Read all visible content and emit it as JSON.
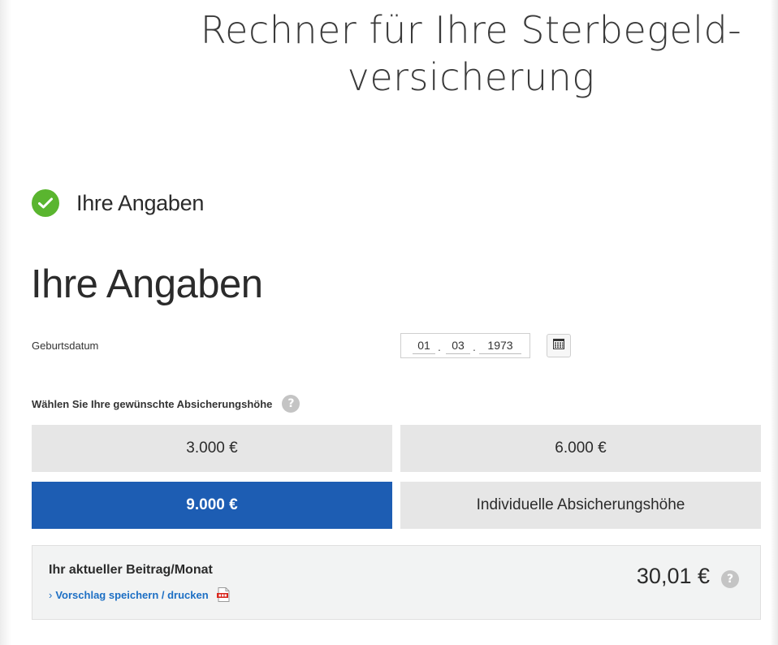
{
  "page": {
    "title_line1": "Rechner für Ihre Sterbegeld-",
    "title_line2": "versicherung"
  },
  "step": {
    "label": "Ihre Angaben",
    "status_icon": "check-circle-icon",
    "status_color": "#5ab52f"
  },
  "form": {
    "heading": "Ihre Angaben",
    "birthdate": {
      "label": "Geburtsdatum",
      "day": "01",
      "month": "03",
      "year": "1973",
      "separator": ".",
      "calendar_icon": "calendar-icon"
    },
    "coverage": {
      "label": "Wählen Sie Ihre gewünschte Absicherungshöhe",
      "help_glyph": "?",
      "options": [
        {
          "label": "3.000 €",
          "selected": false
        },
        {
          "label": "6.000 €",
          "selected": false
        },
        {
          "label": "9.000 €",
          "selected": true
        },
        {
          "label": "Individuelle Absicherungshöhe",
          "selected": false
        }
      ],
      "selected_color": "#1d5db3"
    }
  },
  "result": {
    "title": "Ihr aktueller Beitrag/Monat",
    "link_chevron": "›",
    "link_label": "Vorschlag speichern / drucken",
    "pdf_icon": "pdf-icon",
    "price": "30,01 €",
    "help_glyph": "?"
  }
}
